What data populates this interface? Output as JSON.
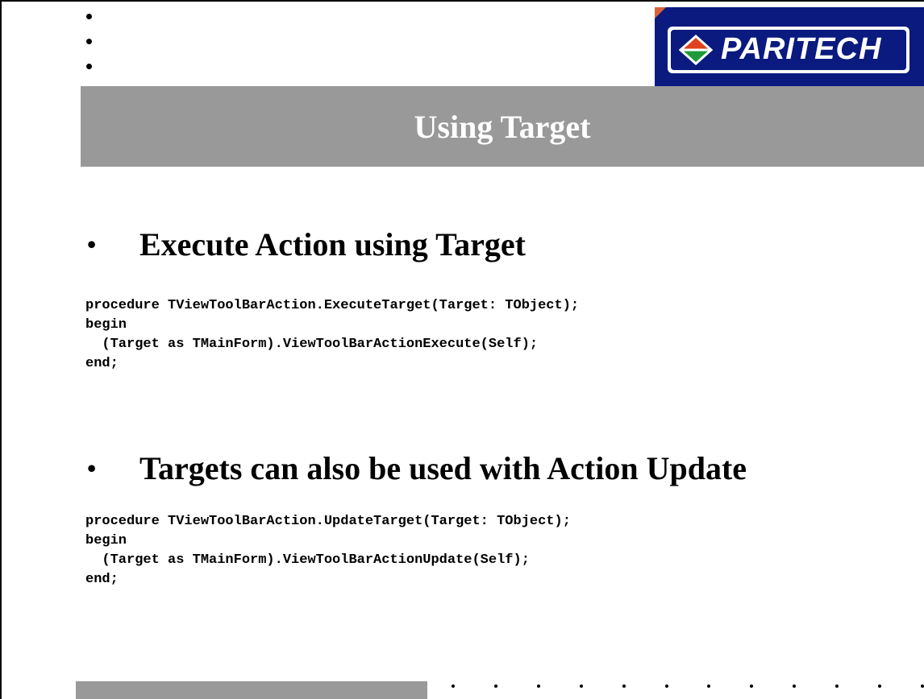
{
  "logo": {
    "text": "PARITECH"
  },
  "slide": {
    "title": "Using Target",
    "sections": [
      {
        "bullet": "•",
        "heading": "Execute Action using Target",
        "code": "procedure TViewToolBarAction.ExecuteTarget(Target: TObject);\nbegin\n  (Target as TMainForm).ViewToolBarActionExecute(Self);\nend;"
      },
      {
        "bullet": "•",
        "heading": "Targets can also be used with Action Update",
        "code": "procedure TViewToolBarAction.UpdateTarget(Target: TObject);\nbegin\n  (Target as TMainForm).ViewToolBarActionUpdate(Self);\nend;"
      }
    ]
  },
  "colors": {
    "title_bar": "#999999",
    "logo_background": "#0a1a7e",
    "logo_diamond_top": "#e0411e",
    "logo_diamond_bottom": "#1f9a3a"
  }
}
